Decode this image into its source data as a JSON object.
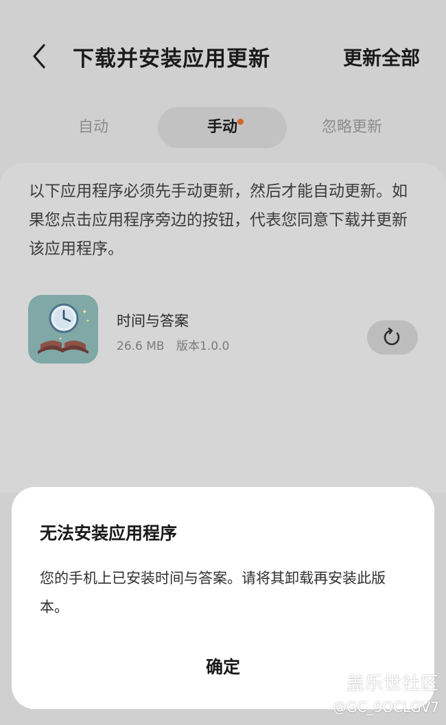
{
  "header": {
    "back_icon": "chevron-left-icon",
    "title": "下载并安装应用更新",
    "update_all_label": "更新全部"
  },
  "tabs": [
    {
      "label": "自动",
      "active": false
    },
    {
      "label": "手动",
      "active": true,
      "badge_dot": true
    },
    {
      "label": "忽略更新",
      "active": false
    }
  ],
  "description": "以下应用程序必须先手动更新，然后才能自动更新。如果您点击应用程序旁边的按钮，代表您同意下载并更新该应用程序。",
  "app": {
    "icon": "clock-book-app-icon",
    "name": "时间与答案",
    "size": "26.6 MB",
    "version": "版本1.0.0",
    "action_icon": "refresh-icon"
  },
  "dialog": {
    "title": "无法安装应用程序",
    "message": "您的手机上已安装时间与答案。请将其卸载再安装此版本。",
    "confirm_label": "确定"
  },
  "watermark": {
    "brand": "盖乐世社区",
    "user": "@GC_9OCLGV7"
  },
  "colors": {
    "background": "#d0d0d0",
    "dialog": "#ffffff",
    "badge": "#d2642a",
    "active_tab": "#c2c2c2"
  }
}
